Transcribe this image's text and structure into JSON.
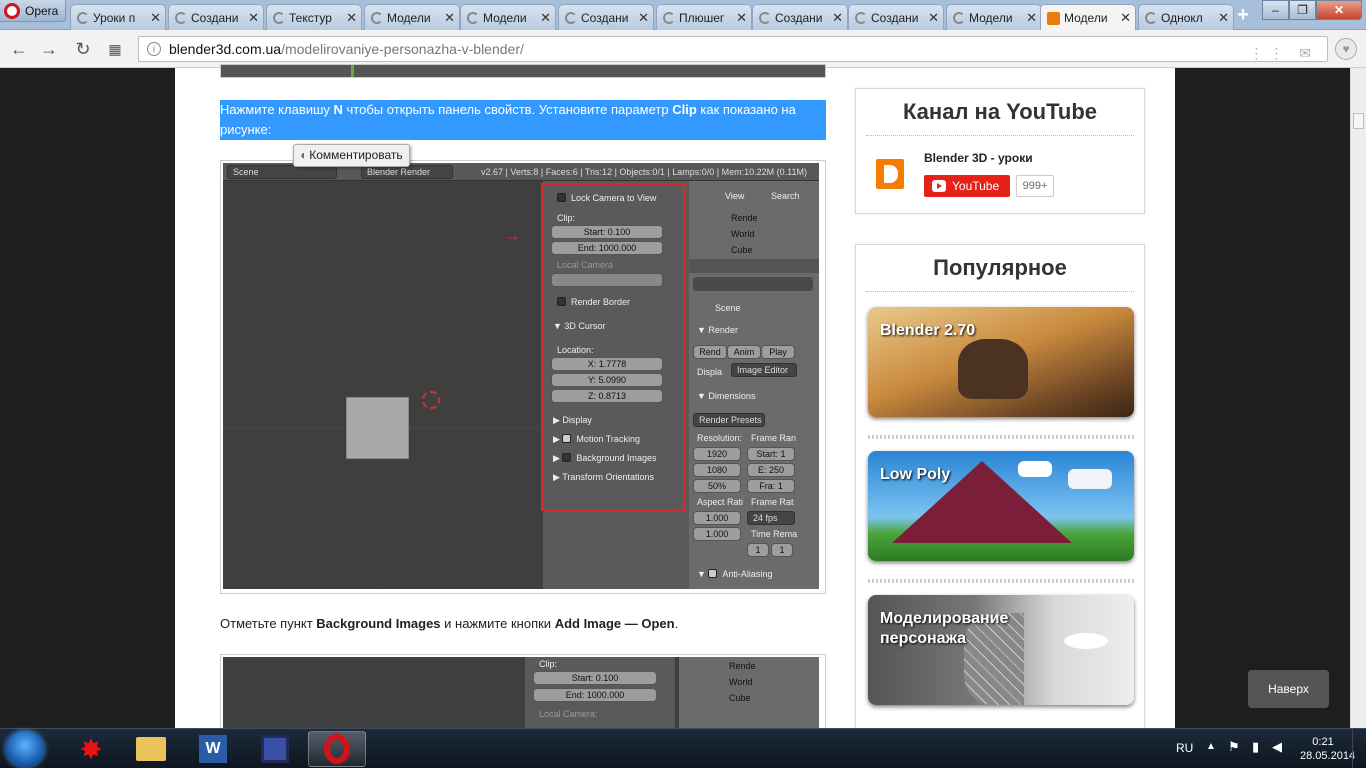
{
  "browser": {
    "menu_label": "Opera",
    "tabs": [
      {
        "label": "Уроки п"
      },
      {
        "label": "Создани"
      },
      {
        "label": "Текстур"
      },
      {
        "label": "Модели"
      },
      {
        "label": "Модели"
      },
      {
        "label": "Создани"
      },
      {
        "label": "Плюшег"
      },
      {
        "label": "Создани"
      },
      {
        "label": "Создани"
      },
      {
        "label": "Модели"
      },
      {
        "label": "Модели"
      },
      {
        "label": "Однокл"
      }
    ],
    "new_tab": "+",
    "url_domain": "blender3d.com.ua",
    "url_path": "/modelirovaniye-personazha-v-blender/"
  },
  "article": {
    "para1_a": "Нажмите клавишу ",
    "para1_key": "N",
    "para1_b": " чтобы открыть панель свойств. Установите параметр ",
    "para1_param": "Clip",
    "para1_c": " как показано на рисунке:",
    "tooltip": "Комментировать",
    "para2_a": "Отметьте пункт ",
    "para2_item": "Background Images",
    "para2_b": " и нажмите кнопки ",
    "para2_btn": "Add Image — Open",
    "para2_c": "."
  },
  "blender1": {
    "scene": "Scene",
    "engine": "Blender Render",
    "stats": "v2.67 | Verts:8 | Faces:6 | Tris:12 | Objects:0/1 | Lamps:0/0 | Mem:10.22M (0.11M)",
    "lock_camera": "Lock Camera to View",
    "clip": "Clip:",
    "start": "Start: 0.100",
    "end": "End: 1000.000",
    "local_camera": "Local Camera",
    "render_border": "Render Border",
    "cursor_3d": "3D Cursor",
    "location": "Location:",
    "x": "X: 1.7778",
    "y": "Y: 5.0990",
    "z": "Z: 0.8713",
    "display": "Display",
    "motion_tracking": "Motion Tracking",
    "background_images": "Background Images",
    "transform_orientations": "Transform Orientations",
    "view": "View",
    "search": "Search",
    "tree_render": "Rende",
    "tree_world": "World",
    "tree_cube": "Cube",
    "scene_label": "Scene",
    "render": "Render",
    "rend_btn": "Rend",
    "anim_btn": "Anim",
    "play_btn": "Play",
    "displa": "Displa",
    "image_editor": "Image Editor",
    "dimensions": "Dimensions",
    "render_presets": "Render Presets",
    "resolution": "Resolution:",
    "frame_range": "Frame Ran",
    "res_x": "1920",
    "res_y": "1080",
    "res_pct": "50%",
    "frame_start": "Start: 1",
    "frame_end": "E: 250",
    "frame_step": "Fra: 1",
    "aspect": "Aspect Rati",
    "frame_rate": "Frame Rat",
    "asp_x": "1.000",
    "asp_y": "1.000",
    "fps": "24 fps",
    "time_remap": "Time Rema",
    "tr_a": "1",
    "tr_b": "1",
    "anti_aliasing": "Anti-Aliasing"
  },
  "blender2": {
    "clip": "Clip:",
    "start": "Start: 0.100",
    "end": "End: 1000.000",
    "local_camera": "Local Camera:",
    "tree_render": "Rende",
    "tree_world": "World",
    "tree_cube": "Cube"
  },
  "sidebar": {
    "youtube_title": "Канал на YouTube",
    "channel_name": "Blender 3D - уроки",
    "youtube_button": "YouTube",
    "subscriber_count": "999+",
    "popular_title": "Популярное",
    "popular": [
      {
        "title": "Blender 2.70"
      },
      {
        "title": "Low Poly"
      },
      {
        "title": "Моделирование персонажа"
      }
    ]
  },
  "back_to_top": "Наверх",
  "taskbar": {
    "language": "RU",
    "time": "0:21",
    "date": "28.05.2014"
  },
  "colors": {
    "selection": "#3399ff",
    "highlight_box": "#d32e2e",
    "youtube_red": "#e62117"
  }
}
